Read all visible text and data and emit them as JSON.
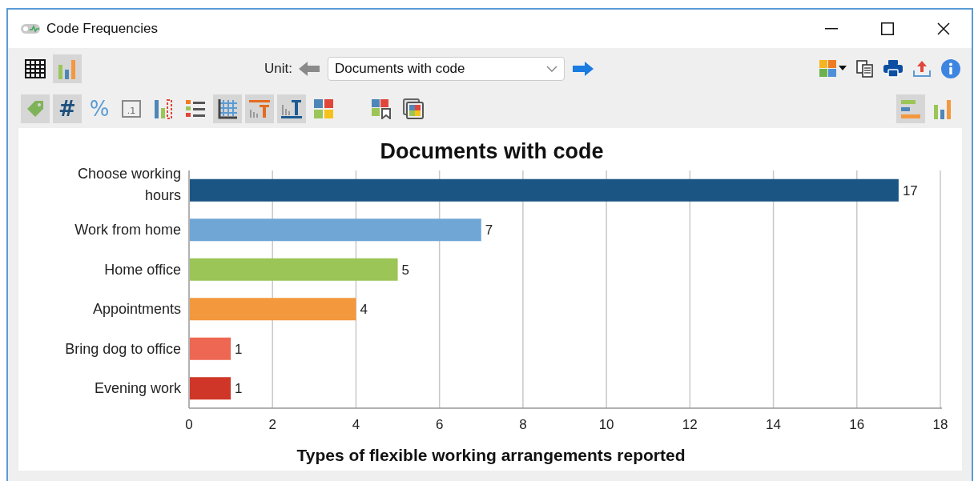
{
  "window": {
    "title": "Code Frequencies"
  },
  "toolbar": {
    "view_buttons": [
      {
        "kind": "table",
        "selected": false
      },
      {
        "kind": "chart",
        "selected": true
      }
    ],
    "unit": {
      "label": "Unit:",
      "value": "Documents with code"
    },
    "format_buttons": [
      {
        "kind": "tag",
        "selected": true
      },
      {
        "kind": "hash",
        "label": "#",
        "selected": true
      },
      {
        "kind": "percent",
        "label": "%",
        "selected": false
      },
      {
        "kind": "decimal",
        "label": ".1",
        "selected": false
      },
      {
        "kind": "bars-dotted",
        "selected": false
      },
      {
        "kind": "legend",
        "selected": false
      },
      {
        "kind": "grid",
        "selected": true
      },
      {
        "kind": "title-top",
        "selected": true
      },
      {
        "kind": "title-bottom",
        "selected": true
      },
      {
        "kind": "colors",
        "selected": false
      }
    ],
    "extra_buttons": [
      {
        "kind": "color-bookmark",
        "selected": false
      },
      {
        "kind": "color-window",
        "selected": false
      }
    ],
    "orientation_buttons": [
      {
        "kind": "horizontal",
        "selected": true
      },
      {
        "kind": "vertical",
        "selected": false
      }
    ]
  },
  "chart": {
    "chart_data": {
      "type": "bar",
      "orientation": "horizontal",
      "title": "Documents with code",
      "xlabel": "Types of flexible working arrangements reported",
      "categories": [
        "Choose working hours",
        "Work from home",
        "Home office",
        "Appointments",
        "Bring dog to office",
        "Evening work"
      ],
      "values": [
        17,
        7,
        5,
        4,
        1,
        1
      ],
      "colors": [
        "#1b5583",
        "#6fa6d6",
        "#9bc556",
        "#f4983e",
        "#ee6752",
        "#cf3628"
      ],
      "xlim": [
        0,
        18
      ],
      "xticks": [
        0,
        2,
        4,
        6,
        8,
        10,
        12,
        14,
        16,
        18
      ],
      "data_labels": true,
      "grid": true
    }
  }
}
